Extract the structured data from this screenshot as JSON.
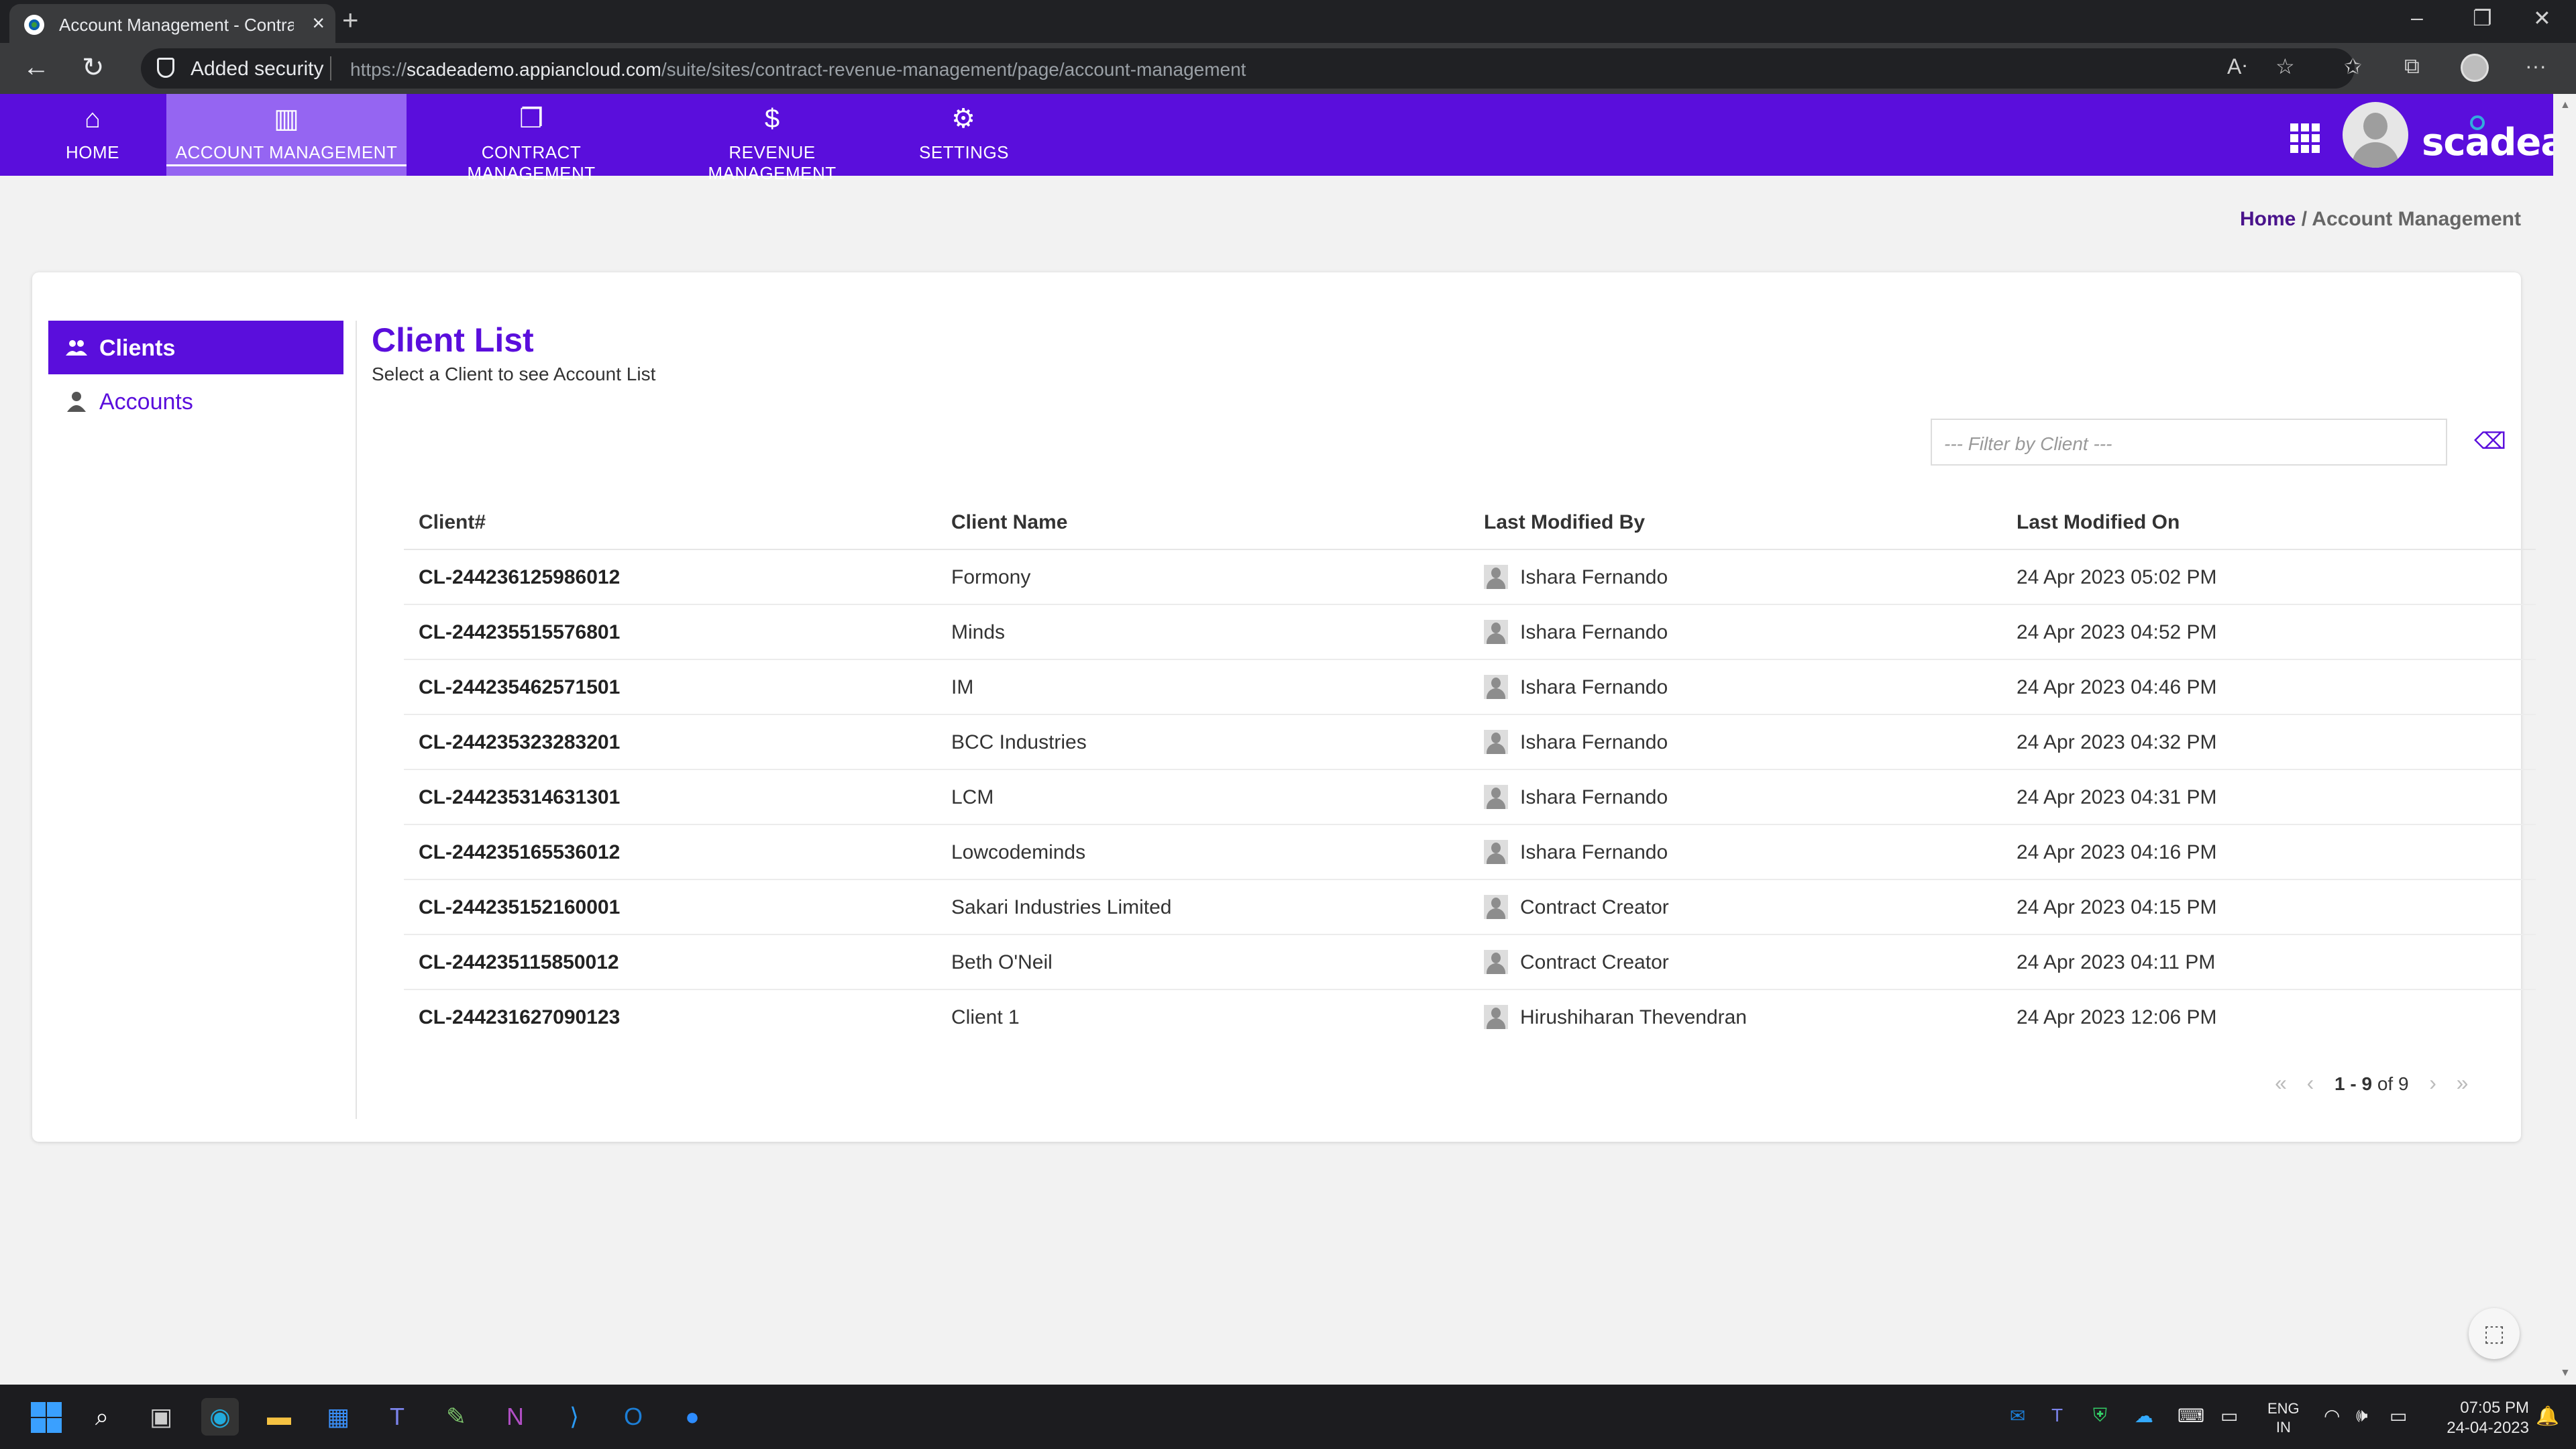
{
  "browser": {
    "tab_title": "Account Management - Contract",
    "security_label": "Added security",
    "url_prefix": "https://",
    "url_domain": "scadeademo.appiancloud.com",
    "url_path": "/suite/sites/contract-revenue-management/page/account-management"
  },
  "nav": {
    "items": [
      {
        "label": "HOME",
        "icon": "home-icon"
      },
      {
        "label": "ACCOUNT MANAGEMENT",
        "icon": "building-icon",
        "active": true
      },
      {
        "label": "CONTRACT MANAGEMENT",
        "icon": "document-icon"
      },
      {
        "label": "REVENUE MANAGEMENT",
        "icon": "dollar-icon"
      },
      {
        "label": "SETTINGS",
        "icon": "gear-icon"
      }
    ],
    "logo": "scadea"
  },
  "breadcrumb": {
    "home": "Home",
    "separator": " / ",
    "current": "Account Management"
  },
  "sidebar": {
    "items": [
      {
        "label": "Clients",
        "active": true
      },
      {
        "label": "Accounts",
        "active": false
      }
    ]
  },
  "content": {
    "title": "Client List",
    "subtitle": "Select a Client to see Account List",
    "filter_placeholder": "--- Filter by Client ---"
  },
  "table": {
    "headers": [
      "Client#",
      "Client Name",
      "Last Modified By",
      "Last Modified On"
    ],
    "rows": [
      {
        "id": "CL-244236125986012",
        "name": "Formony",
        "modified_by": "Ishara Fernando",
        "modified_on": "24 Apr 2023 05:02 PM"
      },
      {
        "id": "CL-244235515576801",
        "name": "Minds",
        "modified_by": "Ishara Fernando",
        "modified_on": "24 Apr 2023 04:52 PM"
      },
      {
        "id": "CL-244235462571501",
        "name": "IM",
        "modified_by": "Ishara Fernando",
        "modified_on": "24 Apr 2023 04:46 PM"
      },
      {
        "id": "CL-244235323283201",
        "name": "BCC Industries",
        "modified_by": "Ishara Fernando",
        "modified_on": "24 Apr 2023 04:32 PM"
      },
      {
        "id": "CL-244235314631301",
        "name": "LCM",
        "modified_by": "Ishara Fernando",
        "modified_on": "24 Apr 2023 04:31 PM"
      },
      {
        "id": "CL-244235165536012",
        "name": "Lowcodeminds",
        "modified_by": "Ishara Fernando",
        "modified_on": "24 Apr 2023 04:16 PM"
      },
      {
        "id": "CL-244235152160001",
        "name": "Sakari Industries Limited",
        "modified_by": "Contract Creator",
        "modified_on": "24 Apr 2023 04:15 PM"
      },
      {
        "id": "CL-244235115850012",
        "name": "Beth O'Neil",
        "modified_by": "Contract Creator",
        "modified_on": "24 Apr 2023 04:11 PM"
      },
      {
        "id": "CL-244231627090123",
        "name": "Client 1",
        "modified_by": "Hirushiharan Thevendran",
        "modified_on": "24 Apr 2023 12:06 PM"
      }
    ]
  },
  "pagination": {
    "range": "1 - 9",
    "of": "of",
    "total": "9"
  },
  "taskbar": {
    "lang_line1": "ENG",
    "lang_line2": "IN",
    "time": "07:05 PM",
    "date": "24-04-2023"
  },
  "colors": {
    "brand": "#5a0edc",
    "nav_active": "#9565f2"
  }
}
